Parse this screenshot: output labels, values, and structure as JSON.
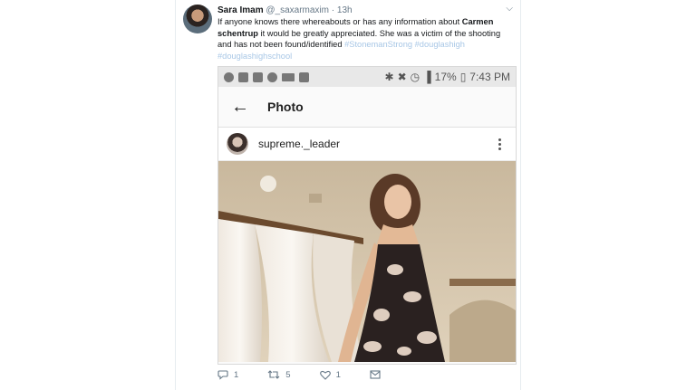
{
  "tweet": {
    "name": "Sara Imam",
    "handle": "@_saxarmaxim",
    "separator": "·",
    "time": "13h",
    "text_part1": "If anyone knows there whereabouts or has any information about ",
    "bold1": "Carmen schentrup",
    "text_part2": " it would be greatly appreciated. She was a victim of the shooting and has not been found/identified ",
    "hashtags": [
      "#StonemanStrong",
      "#douglashigh",
      "#douglashighschool"
    ]
  },
  "screenshot": {
    "statusbar": {
      "battery": "17%",
      "time": "7:43 PM"
    },
    "appbar_title": "Photo",
    "username": "supreme._leader"
  },
  "actions": {
    "replies": "1",
    "retweets": "5",
    "likes": "1"
  },
  "colors": {
    "hashtag": "#a8c7e6",
    "muted": "#657786"
  }
}
